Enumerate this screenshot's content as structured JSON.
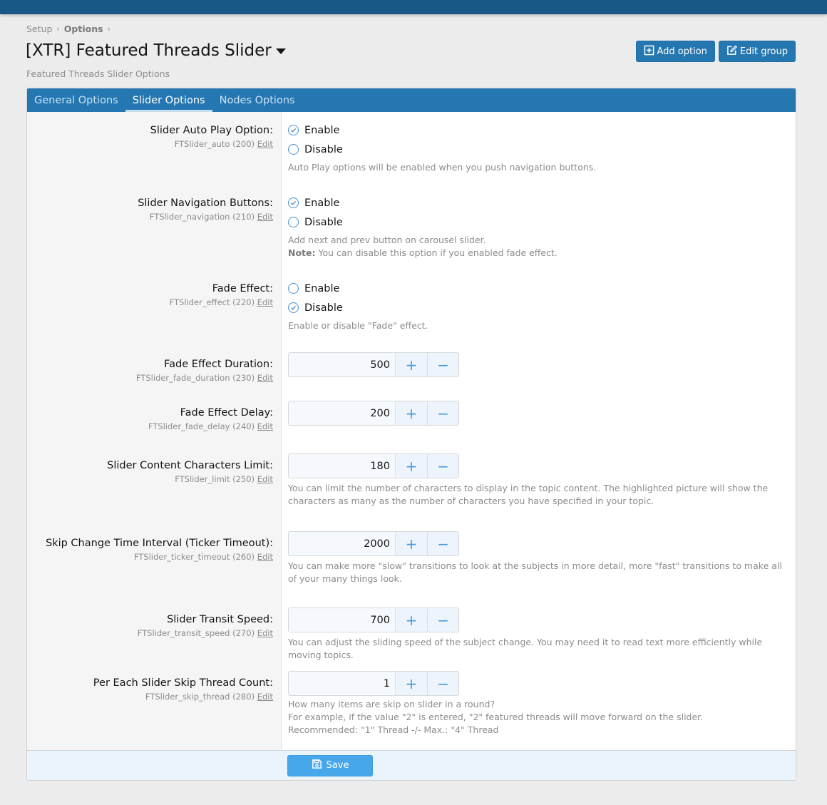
{
  "breadcrumb": [
    {
      "label": "Setup"
    },
    {
      "label": "Options"
    }
  ],
  "page": {
    "title": "[XTR] Featured Threads Slider",
    "subtitle": "Featured Threads Slider Options"
  },
  "actions": {
    "add_option": "Add option",
    "edit_group": "Edit group"
  },
  "tabs": [
    {
      "label": "General Options",
      "active": false
    },
    {
      "label": "Slider Options",
      "active": true
    },
    {
      "label": "Nodes Options",
      "active": false
    }
  ],
  "edit_label": "Edit",
  "options": [
    {
      "label": "Slider Auto Play Option:",
      "key": "FTSlider_auto (200)",
      "type": "radio",
      "choices": [
        "Enable",
        "Disable"
      ],
      "selected": "Enable",
      "explain": "Auto Play options will be enabled when you push navigation buttons."
    },
    {
      "label": "Slider Navigation Buttons:",
      "key": "FTSlider_navigation (210)",
      "type": "radio",
      "choices": [
        "Enable",
        "Disable"
      ],
      "selected": "Enable",
      "explain": "Add next and prev button on carousel slider.",
      "note_label": "Note:",
      "note": "You can disable this option if you enabled fade effect."
    },
    {
      "label": "Fade Effect:",
      "key": "FTSlider_effect (220)",
      "type": "radio",
      "choices": [
        "Enable",
        "Disable"
      ],
      "selected": "Disable",
      "explain": "Enable or disable \"Fade\" effect."
    },
    {
      "label": "Fade Effect Duration:",
      "key": "FTSlider_fade_duration (230)",
      "type": "number",
      "value": "500"
    },
    {
      "label": "Fade Effect Delay:",
      "key": "FTSlider_fade_delay (240)",
      "type": "number",
      "value": "200"
    },
    {
      "label": "Slider Content Characters Limit:",
      "key": "FTSlider_limit (250)",
      "type": "number",
      "value": "180",
      "explain": "You can limit the number of characters to display in the topic content. The highlighted picture will show the characters as many as the number of characters you have specified in your topic."
    },
    {
      "label": "Skip Change Time Interval (Ticker Timeout):",
      "key": "FTSlider_ticker_timeout (260)",
      "type": "number",
      "value": "2000",
      "explain": "You can make more \"slow\" transitions to look at the subjects in more detail, more \"fast\" transitions to make all of your many things look."
    },
    {
      "label": "Slider Transit Speed:",
      "key": "FTSlider_transit_speed (270)",
      "type": "number",
      "value": "700",
      "explain": "You can adjust the sliding speed of the subject change. You may need it to read text more efficiently while moving topics."
    },
    {
      "label": "Per Each Slider Skip Thread Count:",
      "key": "FTSlider_skip_thread (280)",
      "type": "number",
      "value": "1",
      "explain_bold": "How many items are skip on slider in a round?",
      "explain": "For example, if the value \"2\" is entered, \"2\" featured threads will move forward on the slider.",
      "explain2": "Recommended: \"1\" Thread -/- Max.: \"4\" Thread"
    }
  ],
  "spinner": {
    "plus": "+",
    "minus": "−"
  },
  "footer": {
    "save": "Save"
  }
}
